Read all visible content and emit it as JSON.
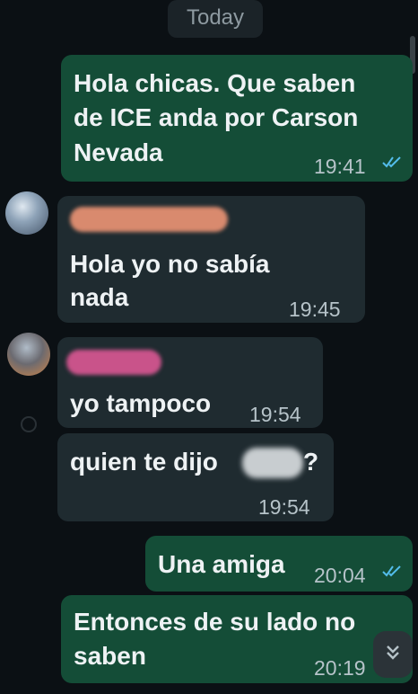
{
  "date_separator": "Today",
  "messages": [
    {
      "text_lines": [
        "Hola chicas. Que saben",
        "de ICE anda por Carson",
        "Nevada"
      ],
      "time": "19:41",
      "direction": "outgoing",
      "read": true
    },
    {
      "text_lines": [
        "Hola yo no sabía",
        "nada"
      ],
      "time": "19:45",
      "direction": "incoming"
    },
    {
      "text": "yo tampoco",
      "time": "19:54",
      "direction": "incoming"
    },
    {
      "text_before_blur": "quien te dijo",
      "text_after_blur": "?",
      "time": "19:54",
      "direction": "incoming"
    },
    {
      "text": "Una amiga",
      "time": "20:04",
      "direction": "outgoing",
      "read": true
    },
    {
      "text_lines": [
        "Entonces de su lado no",
        "saben"
      ],
      "time": "20:19",
      "direction": "outgoing"
    }
  ],
  "icons": {
    "read_receipt": "double-check-icon",
    "scroll_down": "double-chevron-down-icon"
  },
  "colors": {
    "background": "#0b1014",
    "outgoing_bubble": "#144d37",
    "incoming_bubble": "#1f2b30",
    "read_tick": "#53bdeb",
    "sender_name_1": "#d98a6e",
    "sender_name_2": "#c9538a"
  }
}
